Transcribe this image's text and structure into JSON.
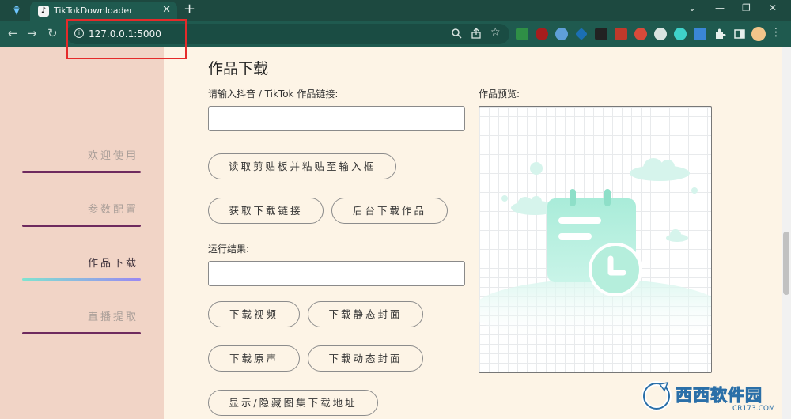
{
  "browser": {
    "tab_title": "TikTokDownloader",
    "tab_favicon": "tiktok-icon",
    "new_tab": "+",
    "close_tab": "✕",
    "window_controls": {
      "dropdown": "⌄",
      "minimize": "—",
      "restore": "❐",
      "close": "✕"
    },
    "url": "127.0.0.1:5000",
    "nav": {
      "back": "←",
      "forward": "→",
      "reload": "↻"
    },
    "omnibox_icons": [
      "zoom-icon",
      "share-icon",
      "bookmark-star-icon"
    ],
    "extensions": [
      "ext-green-icon",
      "ublock-icon",
      "ext-globe-icon",
      "ext-diamond-icon",
      "ext-glasses-icon",
      "ext-red-square-icon",
      "ext-santa-icon",
      "ext-cat-icon",
      "ext-teal-circle-icon",
      "ext-download-icon",
      "puzzle-icon",
      "sidepanel-icon",
      "profile-avatar"
    ],
    "menu": "⋮",
    "accent": "#1f5a4f",
    "highlight_color": "#e52a2a"
  },
  "sidebar": {
    "items": [
      {
        "label": "欢迎使用",
        "active": false
      },
      {
        "label": "参数配置",
        "active": false
      },
      {
        "label": "作品下载",
        "active": true
      },
      {
        "label": "直播提取",
        "active": false
      }
    ]
  },
  "main": {
    "title": "作品下载",
    "link_label": "请输入抖音 / TikTok 作品链接:",
    "link_value": "",
    "buttons": {
      "paste": "读取剪贴板并粘贴至输入框",
      "get_link": "获取下载链接",
      "bg_download": "后台下载作品",
      "download_video": "下载视频",
      "download_static_cover": "下载静态封面",
      "download_audio": "下载原声",
      "download_dynamic_cover": "下载动态封面",
      "toggle_gallery": "显示/隐藏图集下载地址"
    },
    "result_label": "运行结果:",
    "result_value": "",
    "preview_label": "作品预览:",
    "preview_placeholder": "calendar-clock-illustration"
  },
  "watermark": {
    "text": "西西软件园",
    "site": "CR173.COM"
  }
}
